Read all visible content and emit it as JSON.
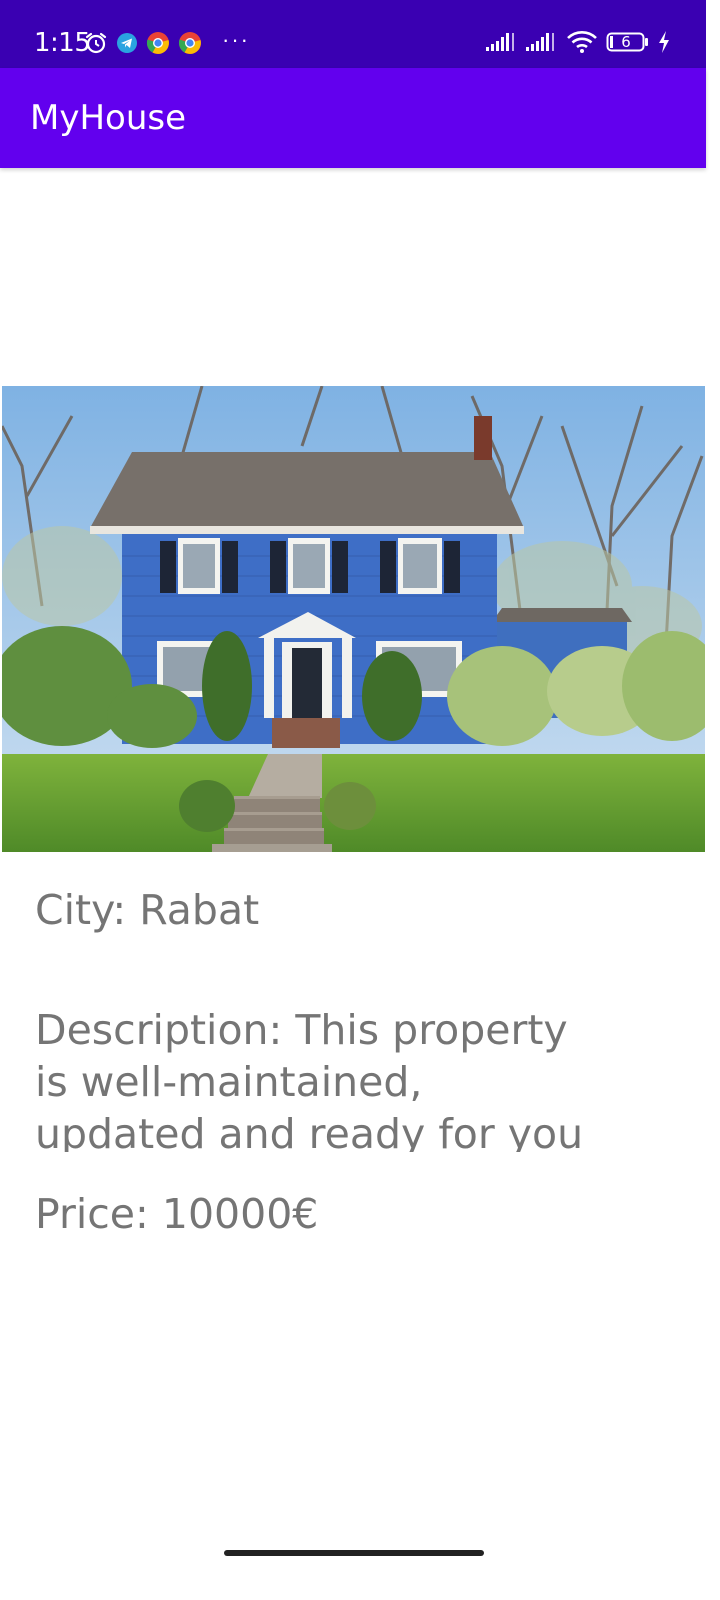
{
  "status_bar": {
    "time": "1:15",
    "battery_level": "6",
    "icons_left": [
      "alarm-icon",
      "telegram-icon",
      "chrome-icon",
      "chrome-icon",
      "more-dots"
    ],
    "icons_right": [
      "signal-icon",
      "signal-icon",
      "wifi-icon",
      "battery-icon",
      "charging-icon"
    ],
    "more_label": "···",
    "color": "#3a00b2"
  },
  "app_bar": {
    "title": "MyHouse",
    "color": "#6200ee"
  },
  "property": {
    "image_icon": "house-photo",
    "city": "City: Rabat",
    "description": "Description: This property is well-maintained, updated and ready for you to call it",
    "price": "Price: 10000€"
  },
  "colors": {
    "text": "#757575",
    "background": "#ffffff"
  }
}
